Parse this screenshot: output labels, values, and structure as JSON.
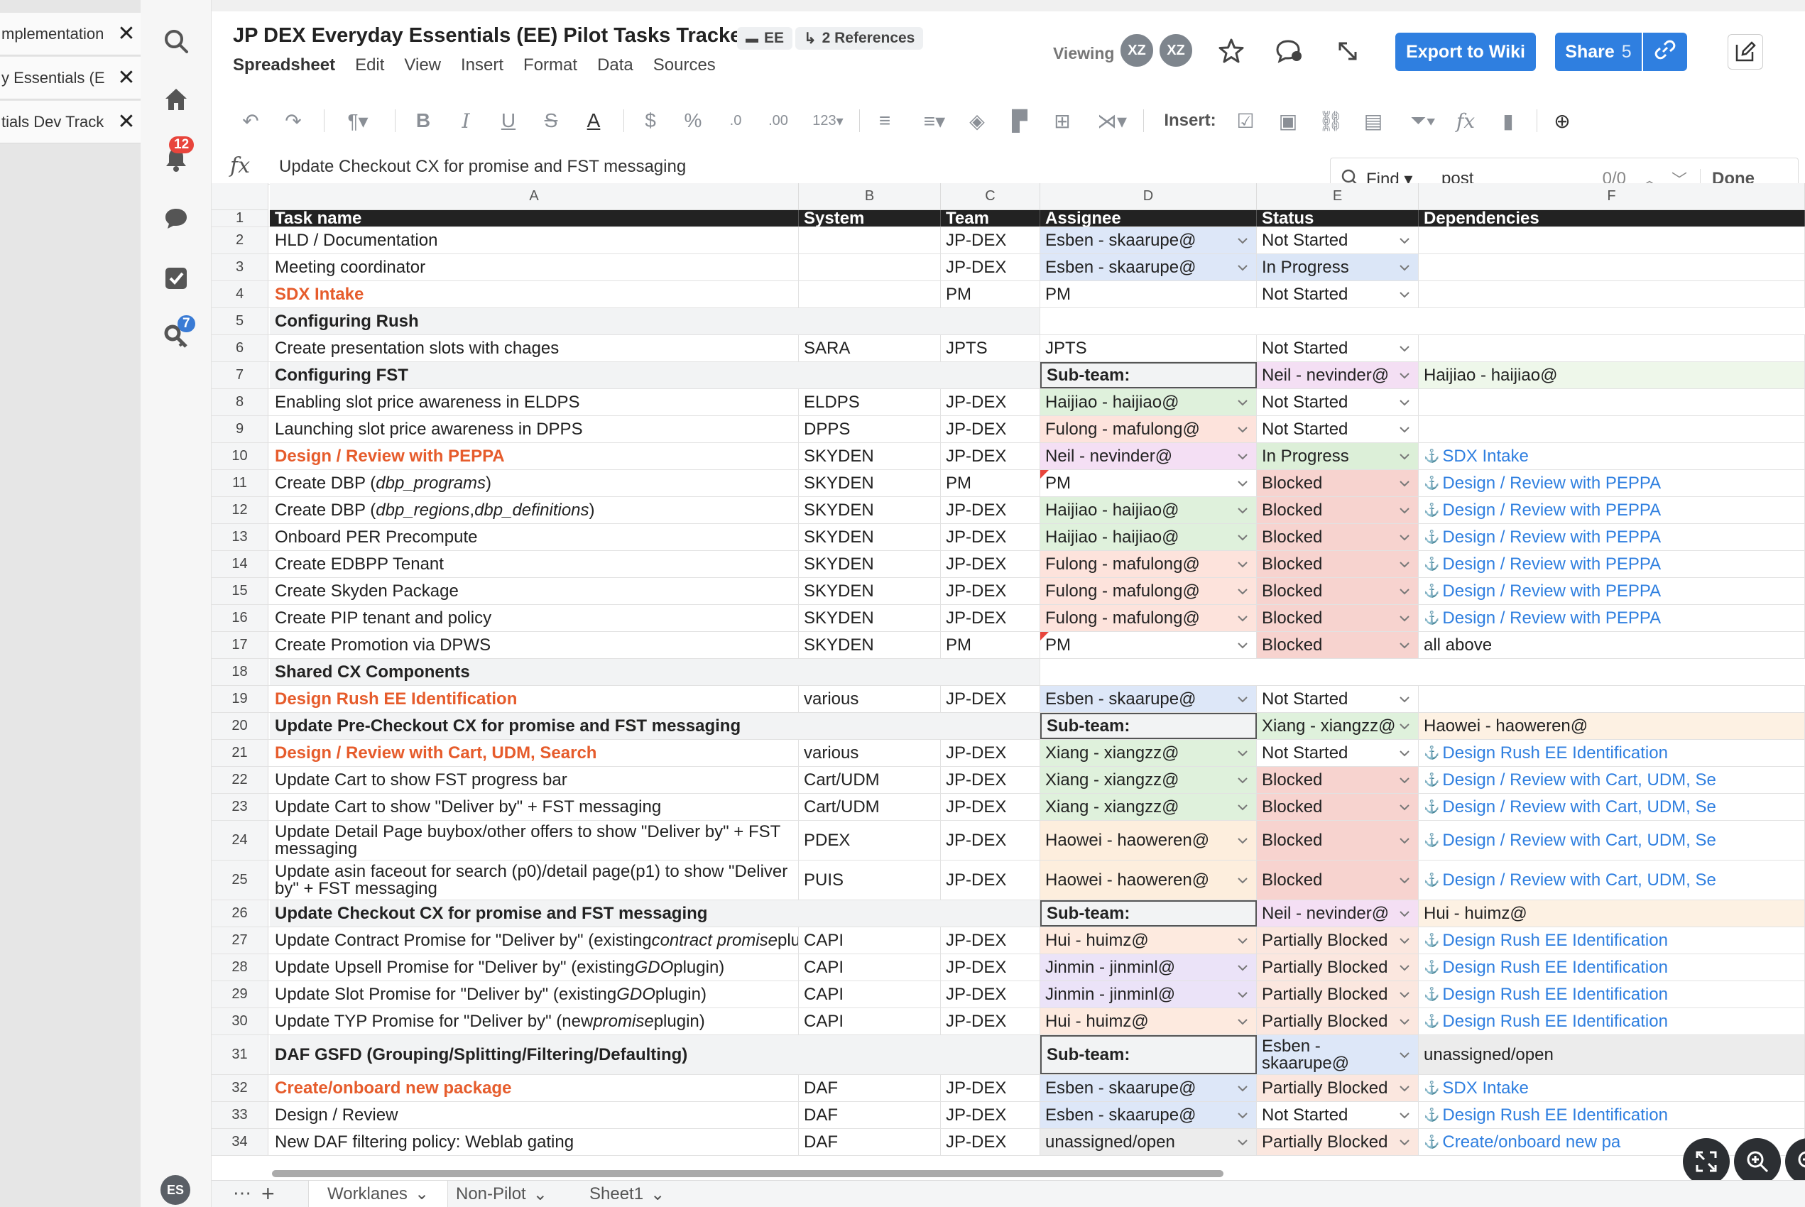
{
  "left_tabs": [
    {
      "label": "mplementation"
    },
    {
      "label": "y Essentials (E"
    },
    {
      "label": "tials Dev Track"
    }
  ],
  "rail": {
    "notifications_count": "12",
    "search_badge": "7",
    "user_initials": "ES"
  },
  "doc": {
    "title": "JP DEX Everyday Essentials (EE) Pilot Tasks Tracker",
    "tag": "EE",
    "references": "2 References"
  },
  "menu": [
    "Spreadsheet",
    "Edit",
    "View",
    "Insert",
    "Format",
    "Data",
    "Sources"
  ],
  "header": {
    "viewing_label": "Viewing",
    "viewer1": "XZ",
    "viewer2": "XZ",
    "export_label": "Export to Wiki",
    "share_label": "Share",
    "share_count": "5"
  },
  "toolbar": {
    "number_format": "123",
    "insert_label": "Insert:"
  },
  "formula_bar": {
    "fx": "fx",
    "value": "Update Checkout CX for promise and FST messaging"
  },
  "find": {
    "label": "Find",
    "query": "post",
    "count": "0/0",
    "done_label": "Done"
  },
  "columns": [
    "A",
    "B",
    "C",
    "D",
    "E",
    "F"
  ],
  "header_row": [
    "Task name",
    "System",
    "Team",
    "Assignee",
    "Status",
    "Dependencies"
  ],
  "rows": [
    {
      "n": "2",
      "task": "HLD / Documentation",
      "system": "",
      "team": "JP-DEX",
      "assignee": "Esben - skaarupe@",
      "status": "Not Started",
      "dep": ""
    },
    {
      "n": "3",
      "task": "Meeting coordinator",
      "system": "",
      "team": "JP-DEX",
      "assignee": "Esben - skaarupe@",
      "status": "In Progress",
      "dep": ""
    },
    {
      "n": "4",
      "task": "SDX Intake",
      "system": "",
      "team": "PM",
      "assignee": "PM",
      "status": "Not Started",
      "dep": ""
    },
    {
      "n": "5",
      "task": "Configuring Rush",
      "section": true
    },
    {
      "n": "6",
      "task": "Create presentation slots with chages",
      "system": "SARA",
      "team": "JPTS",
      "assignee": "JPTS",
      "status": "Not Started",
      "dep": ""
    },
    {
      "n": "7",
      "task": "Configuring FST",
      "section": true,
      "subteam_label": "Sub-team:",
      "subteam_lead": "Neil - nevinder@",
      "subteam_member": "Haijiao - haijiao@"
    },
    {
      "n": "8",
      "task": "Enabling slot price awareness in ELDPS",
      "system": "ELDPS",
      "team": "JP-DEX",
      "assignee": "Haijiao - haijiao@",
      "status": "Not Started",
      "dep": ""
    },
    {
      "n": "9",
      "task": "Launching slot price awareness in DPPS",
      "system": "DPPS",
      "team": "JP-DEX",
      "assignee": "Fulong - mafulong@",
      "status": "Not Started",
      "dep": ""
    },
    {
      "n": "10",
      "task": "Design / Review with PEPPA",
      "system": "SKYDEN",
      "team": "JP-DEX",
      "assignee": "Neil - nevinder@",
      "status": "In Progress",
      "dep": "SDX Intake"
    },
    {
      "n": "11",
      "task": "Create DBP (dbp_programs)",
      "system": "SKYDEN",
      "team": "PM",
      "assignee": "PM",
      "status": "Blocked",
      "dep": "Design / Review with PEPPA"
    },
    {
      "n": "12",
      "task": "Create DBP (dbp_regions, dbp_definitions)",
      "system": "SKYDEN",
      "team": "JP-DEX",
      "assignee": "Haijiao - haijiao@",
      "status": "Blocked",
      "dep": "Design / Review with PEPPA"
    },
    {
      "n": "13",
      "task": "Onboard PER Precompute",
      "system": "SKYDEN",
      "team": "JP-DEX",
      "assignee": "Haijiao - haijiao@",
      "status": "Blocked",
      "dep": "Design / Review with PEPPA"
    },
    {
      "n": "14",
      "task": "Create EDBPP Tenant",
      "system": "SKYDEN",
      "team": "JP-DEX",
      "assignee": "Fulong - mafulong@",
      "status": "Blocked",
      "dep": "Design / Review with PEPPA"
    },
    {
      "n": "15",
      "task": "Create Skyden Package",
      "system": "SKYDEN",
      "team": "JP-DEX",
      "assignee": "Fulong - mafulong@",
      "status": "Blocked",
      "dep": "Design / Review with PEPPA"
    },
    {
      "n": "16",
      "task": "Create PIP tenant and policy",
      "system": "SKYDEN",
      "team": "JP-DEX",
      "assignee": "Fulong - mafulong@",
      "status": "Blocked",
      "dep": "Design / Review with PEPPA"
    },
    {
      "n": "17",
      "task": "Create Promotion via DPWS",
      "system": "SKYDEN",
      "team": "PM",
      "assignee": "PM",
      "status": "Blocked",
      "dep": "all above"
    },
    {
      "n": "18",
      "task": "Shared CX Components",
      "section": true
    },
    {
      "n": "19",
      "task": "Design Rush EE Identification",
      "system": "various",
      "team": "JP-DEX",
      "assignee": "Esben - skaarupe@",
      "status": "Not Started",
      "dep": ""
    },
    {
      "n": "20",
      "task": "Update Pre-Checkout CX for promise and FST messaging",
      "section": true,
      "subteam_label": "Sub-team:",
      "subteam_lead": "Xiang - xiangzz@",
      "subteam_member": "Haowei - haoweren@"
    },
    {
      "n": "21",
      "task": "Design / Review with Cart, UDM, Search",
      "system": "various",
      "team": "JP-DEX",
      "assignee": "Xiang - xiangzz@",
      "status": "Not Started",
      "dep": "Design Rush EE Identification"
    },
    {
      "n": "22",
      "task": "Update Cart to show FST progress bar",
      "system": "Cart/UDM",
      "team": "JP-DEX",
      "assignee": "Xiang - xiangzz@",
      "status": "Blocked",
      "dep": "Design / Review with Cart, UDM, Se"
    },
    {
      "n": "23",
      "task": "Update Cart to show \"Deliver by\" + FST messaging",
      "system": "Cart/UDM",
      "team": "JP-DEX",
      "assignee": "Xiang - xiangzz@",
      "status": "Blocked",
      "dep": "Design / Review with Cart, UDM, Se"
    },
    {
      "n": "24",
      "task": "Update Detail Page buybox/other offers to show \"Deliver by\" + FST messaging",
      "system": "PDEX",
      "team": "JP-DEX",
      "assignee": "Haowei - haoweren@",
      "status": "Blocked",
      "dep": "Design / Review with Cart, UDM, Se"
    },
    {
      "n": "25",
      "task": "Update asin faceout for search (p0)/detail page(p1) to show \"Deliver by\" + FST messaging",
      "system": "PUIS",
      "team": "JP-DEX",
      "assignee": "Haowei - haoweren@",
      "status": "Blocked",
      "dep": "Design / Review with Cart, UDM, Se"
    },
    {
      "n": "26",
      "task": "Update Checkout CX for promise and FST messaging",
      "section": true,
      "subteam_label": "Sub-team:",
      "subteam_lead": "Neil - nevinder@",
      "subteam_member": "Hui - huimz@"
    },
    {
      "n": "27",
      "task": "Update Contract Promise for \"Deliver by\" (existing contract promise plugin)",
      "system": "CAPI",
      "team": "JP-DEX",
      "assignee": "Hui - huimz@",
      "status": "Partially Blocked",
      "dep": "Design Rush EE Identification"
    },
    {
      "n": "28",
      "task": "Update Upsell Promise for \"Deliver by\" (existing GDO plugin)",
      "system": "CAPI",
      "team": "JP-DEX",
      "assignee": "Jinmin - jinminl@",
      "status": "Partially Blocked",
      "dep": "Design Rush EE Identification"
    },
    {
      "n": "29",
      "task": "Update Slot Promise for \"Deliver by\" (existing GDO plugin)",
      "system": "CAPI",
      "team": "JP-DEX",
      "assignee": "Jinmin - jinminl@",
      "status": "Partially Blocked",
      "dep": "Design Rush EE Identification"
    },
    {
      "n": "30",
      "task": "Update TYP Promise for \"Deliver by\" (new promise plugin)",
      "system": "CAPI",
      "team": "JP-DEX",
      "assignee": "Hui - huimz@",
      "status": "Partially Blocked",
      "dep": "Design Rush EE Identification"
    },
    {
      "n": "31",
      "task": "DAF GSFD (Grouping/Splitting/Filtering/Defaulting)",
      "section": true,
      "subteam_label": "Sub-team:",
      "subteam_lead": "Esben - skaarupe@",
      "subteam_member": "unassigned/open"
    },
    {
      "n": "32",
      "task": "Create/onboard new package",
      "system": "DAF",
      "team": "JP-DEX",
      "assignee": "Esben - skaarupe@",
      "status": "Partially Blocked",
      "dep": "SDX Intake"
    },
    {
      "n": "33",
      "task": "Design / Review",
      "system": "DAF",
      "team": "JP-DEX",
      "assignee": "Esben - skaarupe@",
      "status": "Not Started",
      "dep": "Design Rush EE Identification"
    },
    {
      "n": "34",
      "task": "New DAF filtering policy: Weblab gating",
      "system": "DAF",
      "team": "JP-DEX",
      "assignee": "unassigned/open",
      "status": "Partially Blocked",
      "dep": "Create/onboard new pa"
    }
  ],
  "sheet_tabs": [
    "Worklanes",
    "Non-Pilot",
    "Sheet1"
  ],
  "colors": {
    "accent": "#2f7fe0",
    "orange_task": "#e65c2c",
    "blocked": "#f7d3cf",
    "in_progress": "#dcefd8",
    "in_progress_blue": "#dbe6f7"
  }
}
